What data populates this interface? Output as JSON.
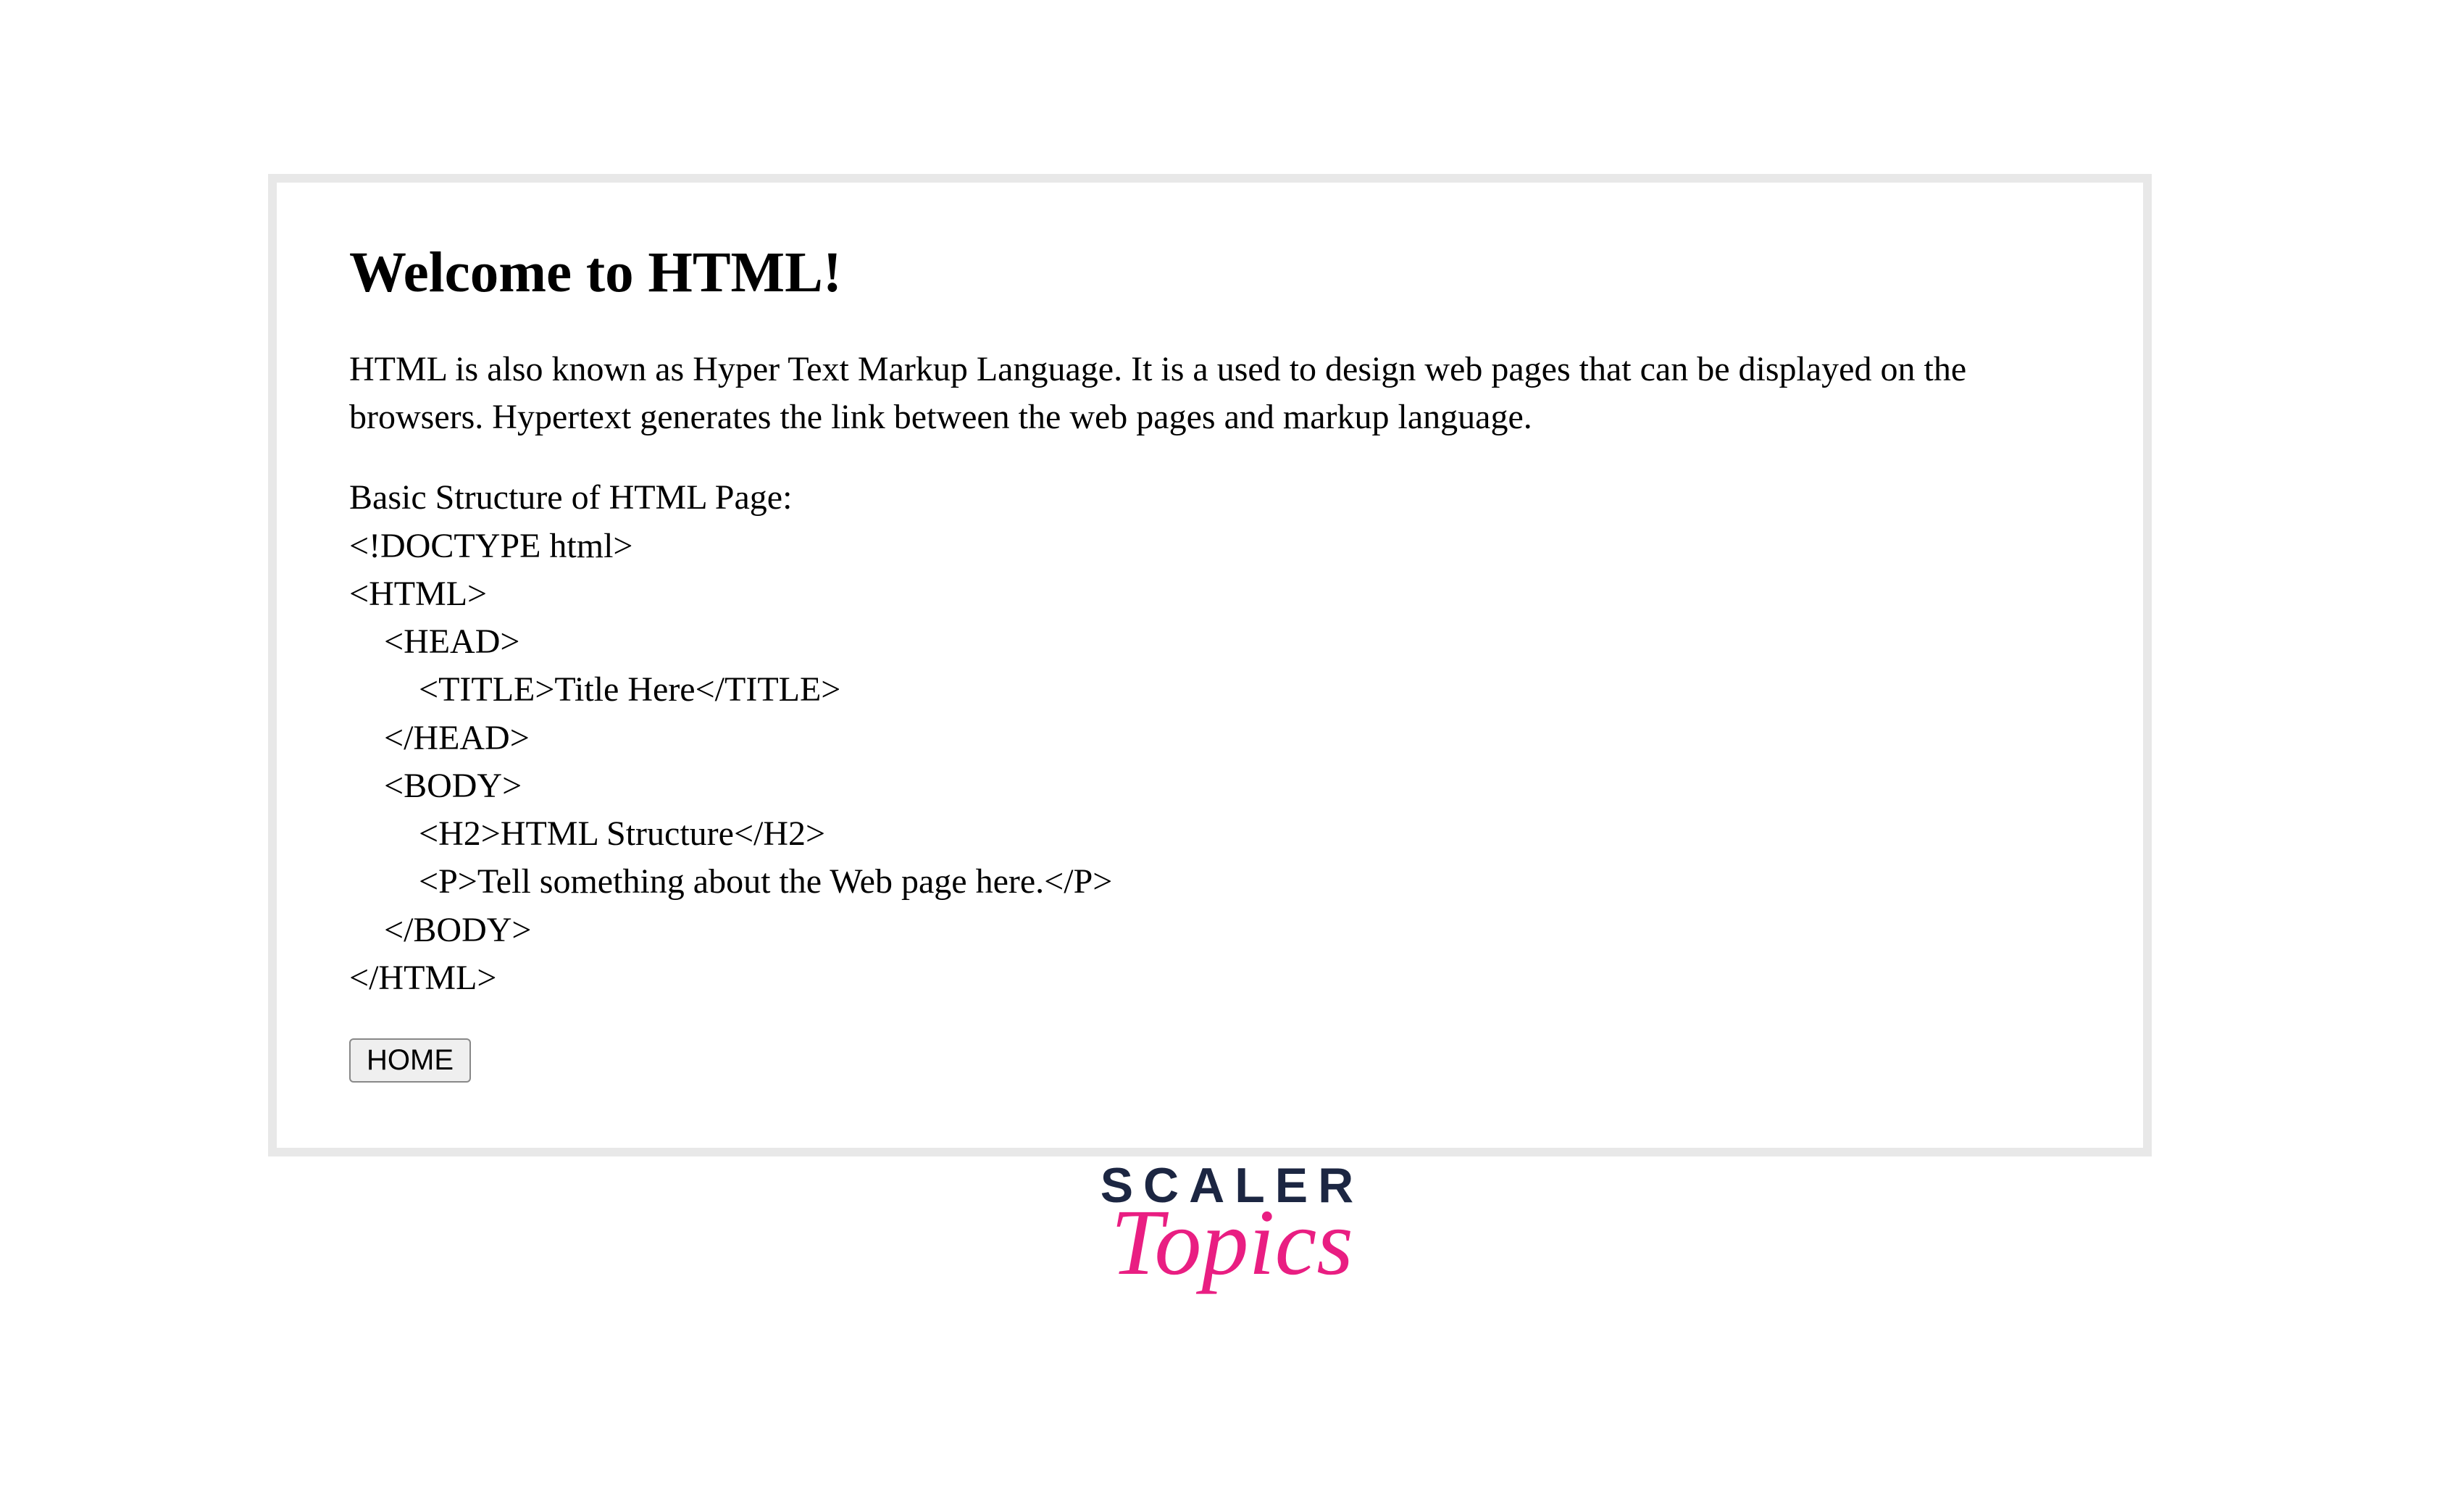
{
  "main": {
    "heading": "Welcome to HTML!",
    "paragraph": "HTML is also known as Hyper Text Markup Language. It is a used to design web pages that can be displayed on the browsers. Hypertext generates the link between the web pages and markup language.",
    "structure": "Basic Structure of HTML Page:\n<!DOCTYPE html>\n<HTML>\n    <HEAD>\n        <TITLE>Title Here</TITLE>\n    </HEAD>\n    <BODY>\n        <H2>HTML Structure</H2>\n        <P>Tell something about the Web page here.</P>\n    </BODY>\n</HTML>",
    "button_label": "HOME"
  },
  "logo": {
    "line1": "SCALER",
    "line2": "Topics"
  }
}
